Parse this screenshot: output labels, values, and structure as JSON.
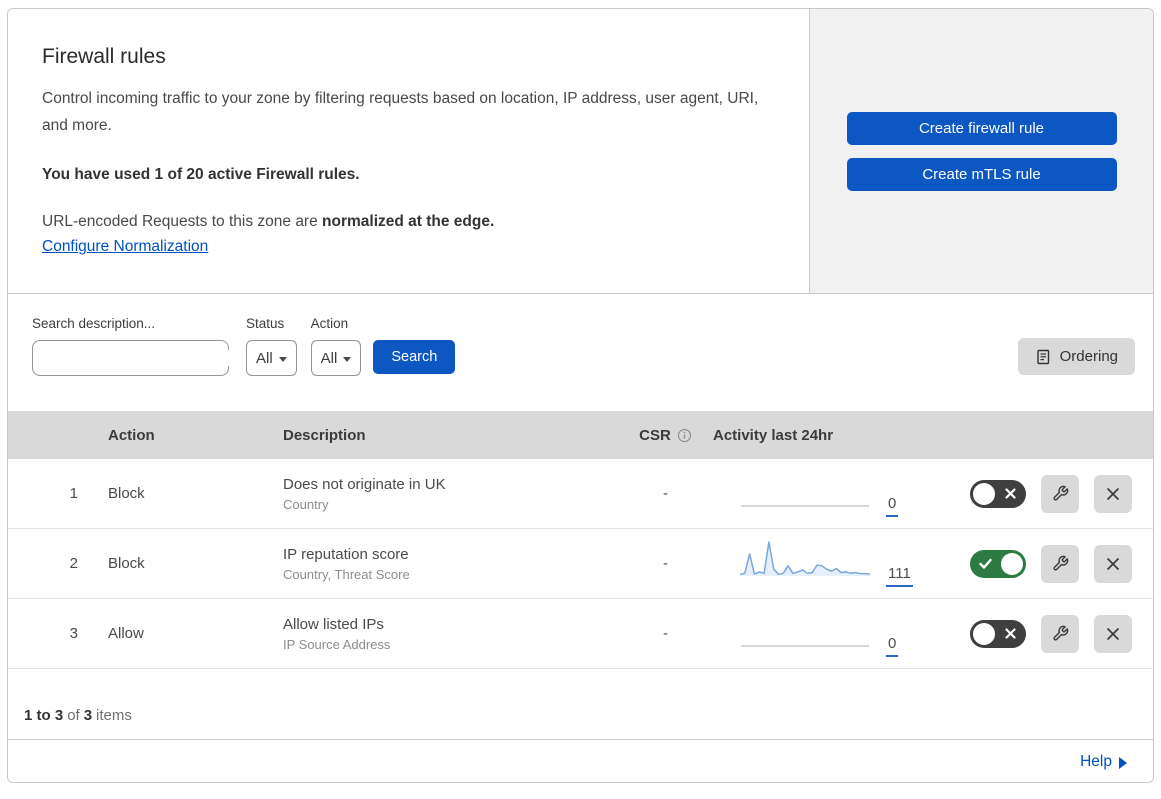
{
  "header": {
    "title": "Firewall rules",
    "description": "Control incoming traffic to your zone by filtering requests based on location, IP address, user agent, URI, and more.",
    "usage_notice": "You have used 1 of 20 active Firewall rules.",
    "normalization_text": "URL-encoded Requests to this zone are ",
    "normalization_bold": "normalized at the edge.",
    "normalization_link": "Configure Normalization",
    "create_firewall_button": "Create firewall rule",
    "create_mtls_button": "Create mTLS rule"
  },
  "filters": {
    "search_label": "Search description...",
    "status_label": "Status",
    "status_value": "All",
    "action_label": "Action",
    "action_value": "All",
    "search_button": "Search",
    "ordering_button": "Ordering"
  },
  "table": {
    "headers": {
      "action": "Action",
      "description": "Description",
      "csr": "CSR",
      "activity": "Activity last 24hr"
    },
    "rows": [
      {
        "number": "1",
        "action": "Block",
        "description": "Does not originate in UK",
        "criteria": "Country",
        "csr": "-",
        "count": "0",
        "enabled": false,
        "activity_points": []
      },
      {
        "number": "2",
        "action": "Block",
        "description": "IP reputation score",
        "criteria": "Country, Threat Score",
        "csr": "-",
        "count": "111",
        "enabled": true,
        "activity_points": [
          5,
          8,
          65,
          6,
          12,
          8,
          100,
          20,
          5,
          8,
          30,
          8,
          12,
          18,
          8,
          10,
          32,
          30,
          20,
          14,
          22,
          10,
          12,
          8,
          10,
          7,
          7,
          6
        ]
      },
      {
        "number": "3",
        "action": "Allow",
        "description": "Allow listed IPs",
        "criteria": "IP Source Address",
        "csr": "-",
        "count": "0",
        "enabled": false,
        "activity_points": []
      }
    ]
  },
  "footer": {
    "range": "1 to 3",
    "of": "of",
    "total": "3",
    "items": "items"
  },
  "help": {
    "label": "Help"
  },
  "colors": {
    "accent_blue": "#0d57c2",
    "link_blue": "#0051c3",
    "toggle_on_green": "#2d7a43",
    "toggle_off_dark": "#3f3f3f",
    "spark_blue": "#7aa7e3",
    "table_header_gray": "#d9d9d9"
  }
}
